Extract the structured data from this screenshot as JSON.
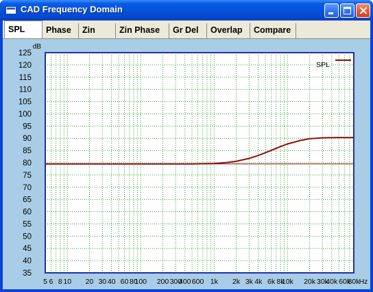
{
  "window": {
    "title": "CAD Frequency Domain"
  },
  "tabs": [
    "SPL",
    "Phase",
    "Zin",
    "Zin Phase",
    "Gr Del",
    "Overlap",
    "Compare"
  ],
  "active_tab": "SPL",
  "colors": {
    "titlebar": "#0450d7",
    "panel_bg": "#a9cde6",
    "grid": "#2f9a2f",
    "frame": "#1f2fa8",
    "curve": "#8b1010"
  },
  "chart_data": {
    "type": "line",
    "y_unit_label": "dB",
    "x_unit_label": "Hz",
    "x_scale": "log",
    "xlim": [
      5,
      80000
    ],
    "ylim": [
      35,
      125
    ],
    "y_ticks": [
      125,
      120,
      115,
      110,
      105,
      100,
      95,
      90,
      85,
      80,
      75,
      70,
      65,
      60,
      55,
      50,
      45,
      40,
      35
    ],
    "x_tick_labels": [
      {
        "label": "5",
        "x": 5
      },
      {
        "label": "6",
        "x": 6
      },
      {
        "label": "8",
        "x": 8
      },
      {
        "label": "10",
        "x": 10
      },
      {
        "label": "20",
        "x": 20
      },
      {
        "label": "30",
        "x": 30
      },
      {
        "label": "40",
        "x": 40
      },
      {
        "label": "60",
        "x": 60
      },
      {
        "label": "80",
        "x": 80
      },
      {
        "label": "100",
        "x": 100
      },
      {
        "label": "200",
        "x": 200
      },
      {
        "label": "300",
        "x": 300
      },
      {
        "label": "400",
        "x": 400
      },
      {
        "label": "600",
        "x": 600
      },
      {
        "label": "1k",
        "x": 1000
      },
      {
        "label": "2k",
        "x": 2000
      },
      {
        "label": "3k",
        "x": 3000
      },
      {
        "label": "4k",
        "x": 4000
      },
      {
        "label": "6k",
        "x": 6000
      },
      {
        "label": "8k",
        "x": 8000
      },
      {
        "label": "10k",
        "x": 10000
      },
      {
        "label": "20k",
        "x": 20000
      },
      {
        "label": "30k",
        "x": 30000
      },
      {
        "label": "40k",
        "x": 40000
      },
      {
        "label": "60k",
        "x": 60000
      },
      {
        "label": "80k",
        "x": 80000
      }
    ],
    "grid": true,
    "reference_line_db": 79.5,
    "legend": {
      "placement": "top-right"
    },
    "series": [
      {
        "name": "SPL",
        "x": [
          5,
          10,
          50,
          100,
          500,
          1000,
          1500,
          2000,
          3000,
          4000,
          5000,
          6000,
          8000,
          10000,
          15000,
          20000,
          30000,
          50000,
          80000
        ],
        "y": [
          79.5,
          79.5,
          79.5,
          79.5,
          79.5,
          79.7,
          80.1,
          80.6,
          81.8,
          83.0,
          84.1,
          85.1,
          86.6,
          87.7,
          89.1,
          89.8,
          90.2,
          90.3,
          90.3
        ]
      }
    ]
  }
}
